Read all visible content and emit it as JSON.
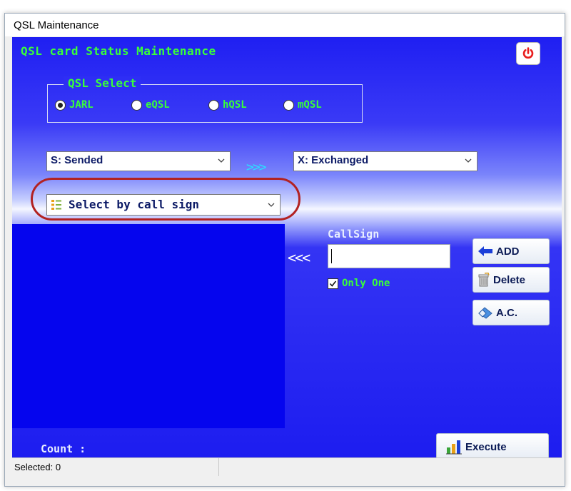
{
  "window": {
    "title": "QSL Maintenance"
  },
  "header": {
    "title": "QSL card Status Maintenance",
    "power_icon": "power-icon",
    "accent_color": "#39ff39"
  },
  "qsl_select": {
    "legend": "QSL Select",
    "options": [
      {
        "label": "JARL",
        "checked": true
      },
      {
        "label": "eQSL",
        "checked": false
      },
      {
        "label": "hQSL",
        "checked": false
      },
      {
        "label": "mQSL",
        "checked": false
      }
    ]
  },
  "status_from": {
    "value": "S: Sended"
  },
  "arrow_right": ">>>",
  "status_to": {
    "value": "X: Exchanged"
  },
  "select_mode": {
    "value": "Select by call sign",
    "icon": "list-icon"
  },
  "arrow_left": "<<<",
  "callsign": {
    "label": "CallSign",
    "value": "",
    "only_one_label": "Only One",
    "only_one_checked": true
  },
  "buttons": {
    "add": "ADD",
    "delete": "Delete",
    "ac": "A.C.",
    "execute": "Execute"
  },
  "count_label": "Count :",
  "status_bar": {
    "selected": "Selected: 0"
  }
}
